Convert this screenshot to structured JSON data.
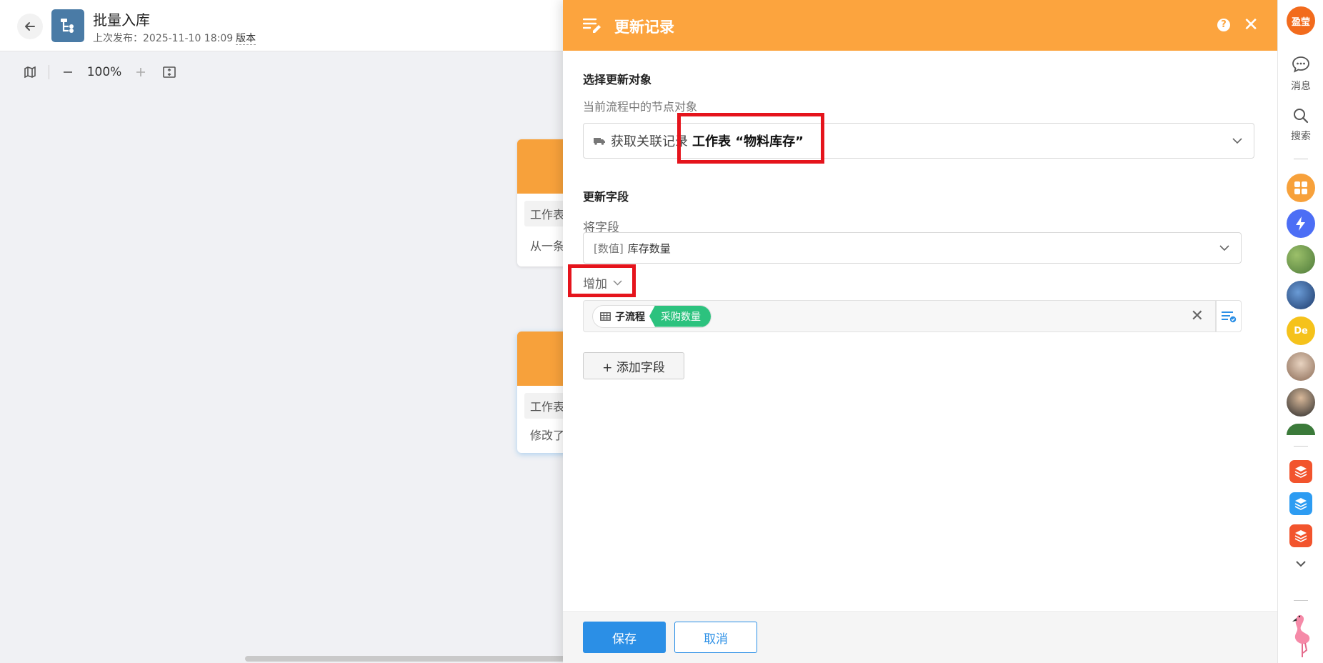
{
  "header": {
    "title": "批量入库",
    "last_publish": "上次发布：2025-11-10 18:09",
    "version_link": "版本"
  },
  "canvas": {
    "zoom": "100%",
    "nodes": [
      {
        "tag": "工作表",
        "desc": "从一条"
      },
      {
        "tag": "工作表",
        "desc": "修改了"
      }
    ]
  },
  "panel": {
    "title": "更新记录",
    "help": "?",
    "close": "✕",
    "target_section_title": "选择更新对象",
    "target_label": "当前流程中的节点对象",
    "target_source": "获取关联记录",
    "target_table": "工作表 “物料库存”",
    "update_fields_title": "更新字段",
    "field_label": "将字段",
    "field_type": "[数值]",
    "field_name": "库存数量",
    "operation": "增加",
    "value_source": "子流程",
    "value_field": "采购数量",
    "add_field_label": "+ 添加字段",
    "save_label": "保存",
    "cancel_label": "取消"
  },
  "sidebar": {
    "user_avatar": "盈莹",
    "messages_label": "消息",
    "search_label": "搜索",
    "member_avatar_text": "De"
  },
  "colors": {
    "header_orange": "#fca43e",
    "primary_blue": "#2b8fe6",
    "token_green": "#2cc27e",
    "highlight_red": "#e5141c",
    "app_icon_blue": "#4a7ba6"
  }
}
